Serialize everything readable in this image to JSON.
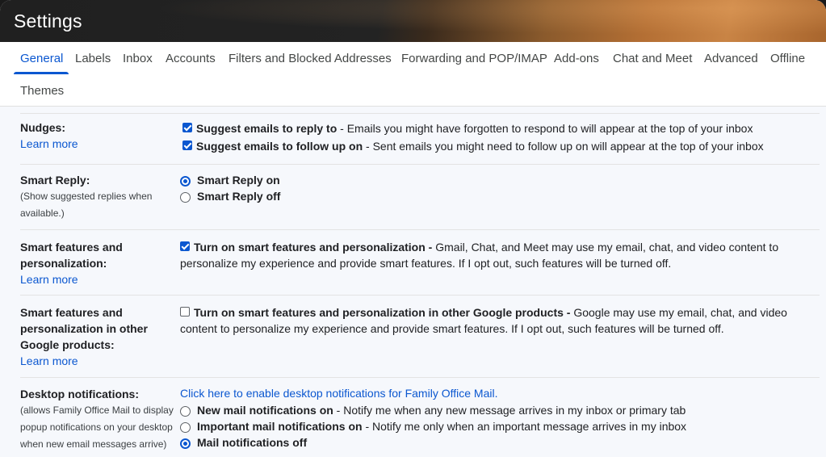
{
  "app": {
    "title": "Settings"
  },
  "tabs": [
    {
      "label": "General",
      "active": true
    },
    {
      "label": "Labels"
    },
    {
      "label": "Inbox"
    },
    {
      "label": "Accounts"
    },
    {
      "label": "Filters and Blocked Addresses"
    },
    {
      "label": "Forwarding and POP/IMAP"
    },
    {
      "label": "Add-ons"
    },
    {
      "label": "Chat and Meet"
    },
    {
      "label": "Advanced"
    },
    {
      "label": "Offline"
    },
    {
      "label": "Themes"
    }
  ],
  "nudges": {
    "title": "Nudges:",
    "learn_more": "Learn more",
    "options": [
      {
        "bold": "Suggest emails to reply to",
        "desc": " - Emails you might have forgotten to respond to will appear at the top of your inbox",
        "checked": true
      },
      {
        "bold": "Suggest emails to follow up on",
        "desc": " - Sent emails you might need to follow up on will appear at the top of your inbox",
        "checked": true
      }
    ]
  },
  "smart_reply": {
    "title": "Smart Reply:",
    "sub1": "(Show suggested replies when",
    "sub2": "available.)",
    "options": [
      {
        "label": "Smart Reply on",
        "selected": true
      },
      {
        "label": "Smart Reply off",
        "selected": false
      }
    ]
  },
  "smart_features": {
    "title1": "Smart features and",
    "title2": "personalization:",
    "learn_more": "Learn more",
    "checked": true,
    "bold": "Turn on smart features and personalization -",
    "desc1": " Gmail, Chat, and Meet may use my email, chat, and video content to",
    "desc2": "personalize my experience and provide smart features. If I opt out, such features will be turned off."
  },
  "smart_features_other": {
    "title1": "Smart features and",
    "title2": "personalization in other",
    "title3": "Google products:",
    "learn_more": "Learn more",
    "checked": false,
    "bold": "Turn on smart features and personalization in other Google products -",
    "desc1": " Google may use my email, chat, and video",
    "desc2": "content to personalize my experience and provide smart features. If I opt out, such features will be turned off."
  },
  "desktop_notifications": {
    "title": "Desktop notifications:",
    "sub1": "(allows Family Office Mail to display",
    "sub2": "popup notifications on your desktop",
    "sub3": "when new email messages arrive)",
    "enable_link": "Click here to enable desktop notifications for Family Office Mail.",
    "options": [
      {
        "bold": "New mail notifications on",
        "desc": " - Notify me when any new message arrives in my inbox or primary tab",
        "selected": false
      },
      {
        "bold": "Important mail notifications on",
        "desc": " - Notify me only when an important message arrives in my inbox",
        "selected": false
      },
      {
        "bold": "Mail notifications off",
        "desc": "",
        "selected": true
      }
    ]
  },
  "colors": {
    "accent": "#0b57d0",
    "header_bg": "#202020",
    "page_bg": "#f6f8fc"
  }
}
